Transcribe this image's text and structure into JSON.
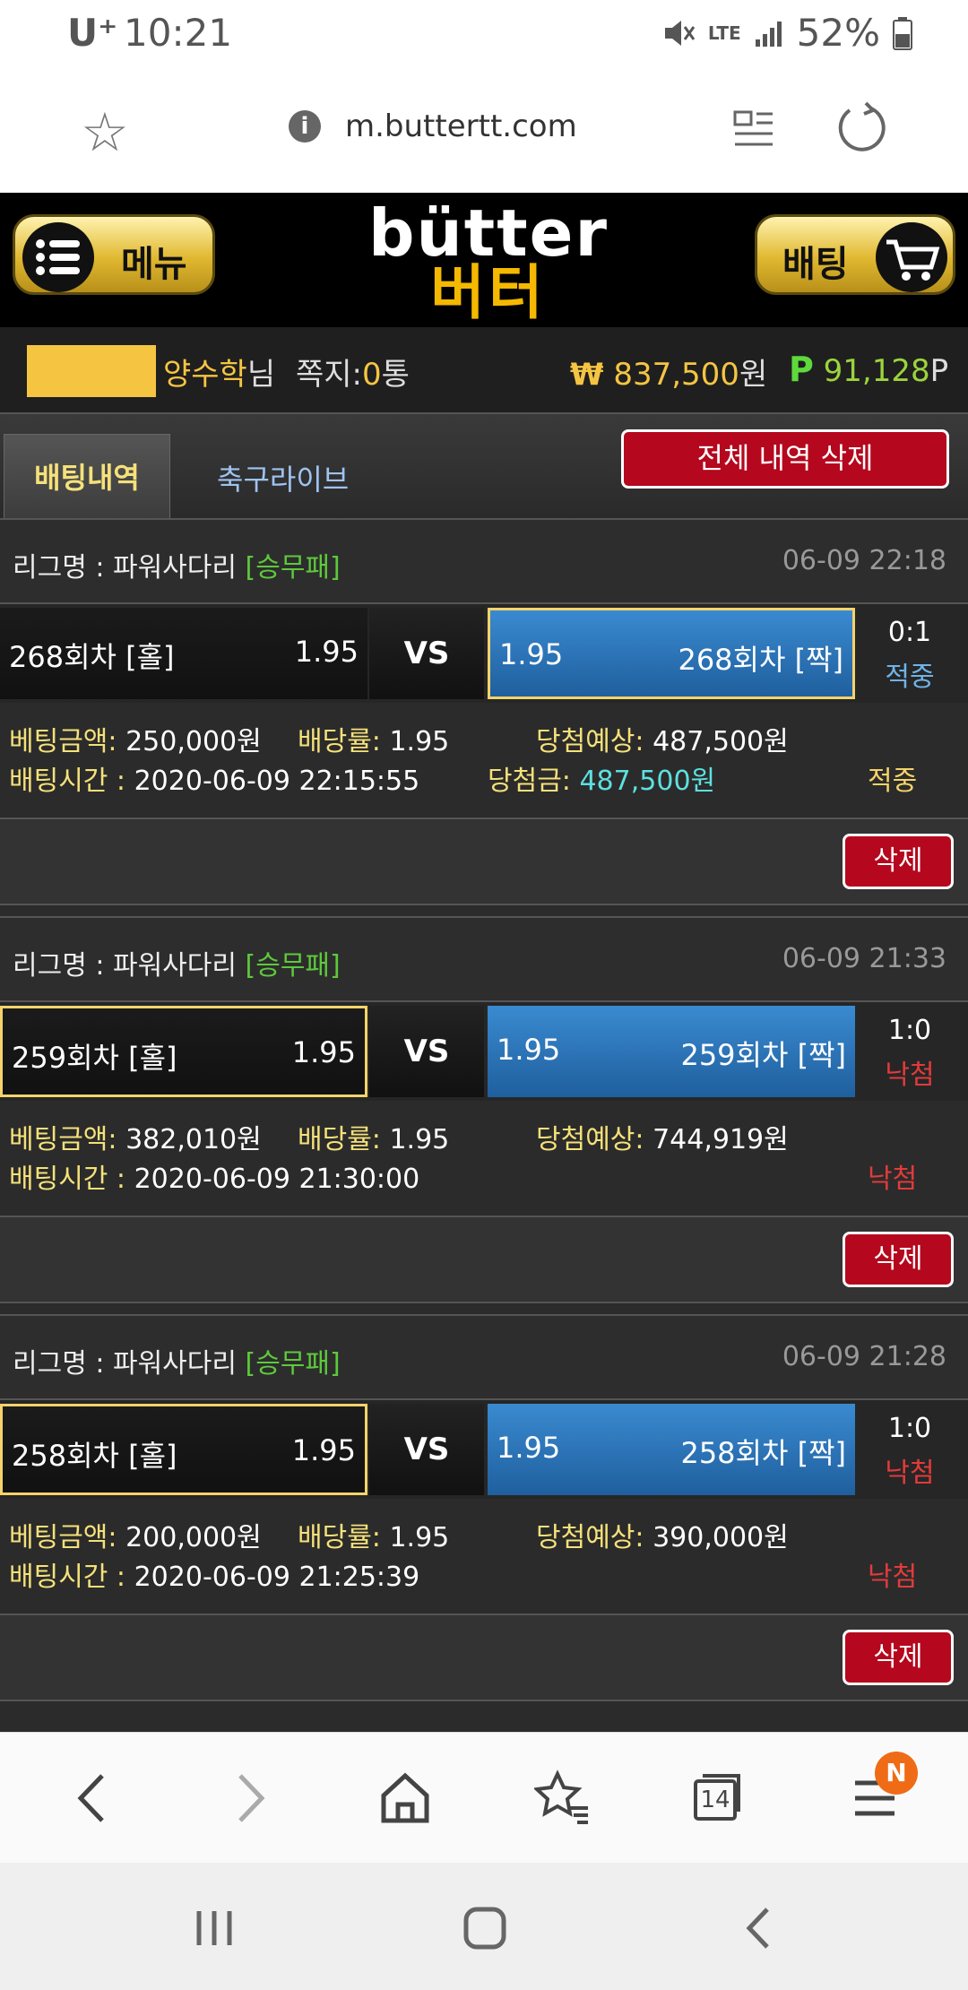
{
  "status": {
    "carrier": "U⁺",
    "time": "10:21",
    "network": "LTE",
    "battery": "52%"
  },
  "browser": {
    "url": "m.buttertt.com"
  },
  "header": {
    "menu_label": "메뉴",
    "betting_label": "배팅",
    "logo_en": "bütter",
    "logo_ko": "버터"
  },
  "user": {
    "name": "양수학",
    "name_suffix": "님",
    "memo_label": "쪽지:",
    "memo_count": "0",
    "memo_suffix": "통",
    "currency_symbol": "₩",
    "money": "837,500",
    "money_suffix": "원",
    "point_symbol": "P",
    "points": "91,128",
    "points_suffix": "P"
  },
  "tabs": {
    "active": "배팅내역",
    "second": "축구라이브",
    "delete_all": "전체 내역 삭제"
  },
  "bets": [
    {
      "league_label": "리그명 : 파워사다리",
      "tag": "[승무패]",
      "date": "06-09 22:18",
      "home_team": "268회차 [홀]",
      "home_odd": "1.95",
      "vs": "VS",
      "away_odd": "1.95",
      "away_team": "268회차 [짝]",
      "score": "0:1",
      "outcome": "적중",
      "amount_label": "베팅금액:",
      "amount": "250,000원",
      "rate_label": "배당률:",
      "rate": "1.95",
      "expected_label": "당첨예상:",
      "expected": "487,500원",
      "time_label": "배팅시간 :",
      "time": "2020-06-09 22:15:55",
      "win_label": "당첨금:",
      "win_amount": "487,500원",
      "result": "적중",
      "delete_label": "삭제"
    },
    {
      "league_label": "리그명 : 파워사다리",
      "tag": "[승무패]",
      "date": "06-09 21:33",
      "home_team": "259회차 [홀]",
      "home_odd": "1.95",
      "vs": "VS",
      "away_odd": "1.95",
      "away_team": "259회차 [짝]",
      "score": "1:0",
      "outcome": "낙첨",
      "amount_label": "베팅금액:",
      "amount": "382,010원",
      "rate_label": "배당률:",
      "rate": "1.95",
      "expected_label": "당첨예상:",
      "expected": "744,919원",
      "time_label": "배팅시간 :",
      "time": "2020-06-09 21:30:00",
      "result": "낙첨",
      "delete_label": "삭제"
    },
    {
      "league_label": "리그명 : 파워사다리",
      "tag": "[승무패]",
      "date": "06-09 21:28",
      "home_team": "258회차 [홀]",
      "home_odd": "1.95",
      "vs": "VS",
      "away_odd": "1.95",
      "away_team": "258회차 [짝]",
      "score": "1:0",
      "outcome": "낙첨",
      "amount_label": "베팅금액:",
      "amount": "200,000원",
      "rate_label": "배당률:",
      "rate": "1.95",
      "expected_label": "당첨예상:",
      "expected": "390,000원",
      "time_label": "배팅시간 :",
      "time": "2020-06-09 21:25:39",
      "result": "낙첨",
      "delete_label": "삭제"
    }
  ],
  "nav": {
    "tabs_count": "14",
    "badge": "N"
  },
  "colors": {
    "gold": "#f5c542",
    "red": "#b5071d",
    "blue": "#1f5f9e",
    "green": "#5ec93c"
  }
}
